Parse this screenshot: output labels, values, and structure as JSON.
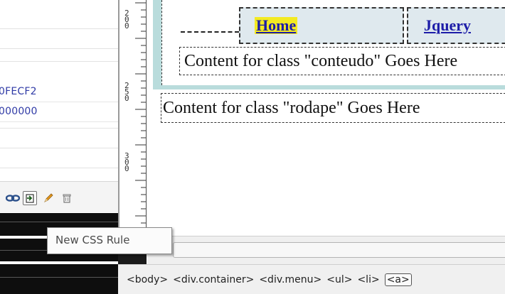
{
  "css_panel": {
    "property_values": [
      "0FECF2",
      "000000"
    ]
  },
  "toolbar": {
    "icons": [
      "link-icon",
      "new-css-rule-icon",
      "edit-pencil-icon",
      "trash-icon"
    ]
  },
  "tooltip": {
    "text": "New CSS Rule"
  },
  "ruler": {
    "labels": [
      "200",
      "250",
      "300"
    ]
  },
  "design": {
    "menu_items": [
      "Home",
      "Jquery"
    ],
    "content_conteudo": "Content for class \"conteudo\" Goes Here",
    "content_rodape": "Content for class \"rodape\" Goes Here"
  },
  "tag_selector": {
    "tags": [
      "<body>",
      "<div.container>",
      "<div.menu>",
      "<ul>",
      "<li>",
      "<a>"
    ],
    "active_index": 5
  },
  "colors": {
    "accent_teal": "#b9dcdc",
    "menu_cell_bg": "#dfe9ee",
    "link_color": "#1d1da8",
    "highlight_yellow": "#f3ea22",
    "property_value_color": "#2f3aa6"
  }
}
